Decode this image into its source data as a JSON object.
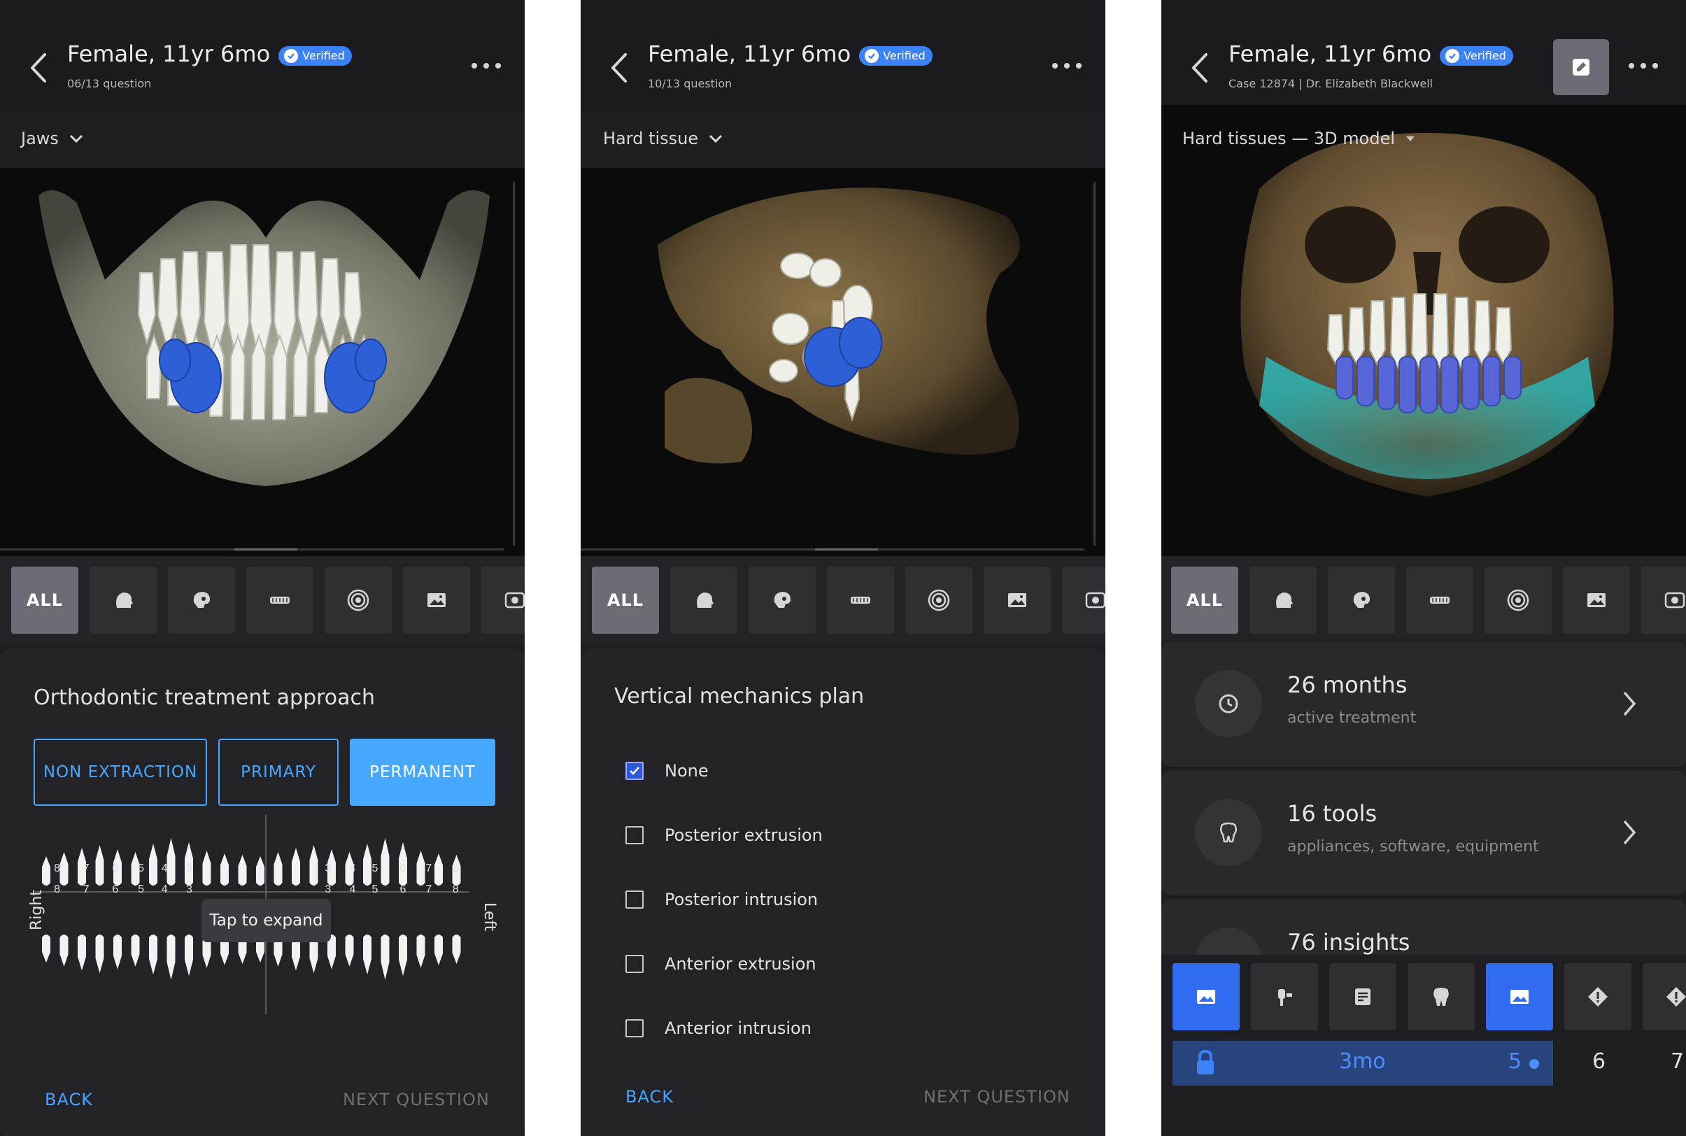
{
  "colors": {
    "accent": "#46a8ff",
    "verified": "#3b82f6",
    "selected_tool": "#2f6cf0",
    "tooth_highlight": "#2d5fd6",
    "bg": "#1e1e22"
  },
  "panels": [
    {
      "header": {
        "title": "Female, 11yr 6mo",
        "badge": "Verified",
        "subtitle": "06/13 question"
      },
      "dropdown": "Jaws",
      "filter_all": "ALL",
      "question": {
        "title": "Orthodontic treatment approach",
        "options": [
          {
            "label": "NON EXTRACTION",
            "selected": false
          },
          {
            "label": "PRIMARY",
            "selected": false
          },
          {
            "label": "PERMANENT",
            "selected": true
          }
        ]
      },
      "tooth_chart": {
        "top_numbers": [
          "8",
          "7",
          "6",
          "5",
          "4",
          "3",
          "3",
          "4",
          "5",
          "6",
          "7",
          "8"
        ],
        "bottom_numbers": [
          "8",
          "7",
          "6",
          "5",
          "4",
          "3",
          "3",
          "4",
          "5",
          "6",
          "7",
          "8"
        ],
        "side_right": "Right",
        "side_left": "Left",
        "tooltip": "Tap to expand"
      },
      "footer": {
        "back": "BACK",
        "next": "NEXT QUESTION"
      }
    },
    {
      "header": {
        "title": "Female, 11yr 6mo",
        "badge": "Verified",
        "subtitle": "10/13 question"
      },
      "dropdown": "Hard tissue",
      "filter_all": "ALL",
      "question": {
        "title": "Vertical mechanics plan",
        "checkboxes": [
          {
            "label": "None",
            "checked": true
          },
          {
            "label": "Posterior extrusion",
            "checked": false
          },
          {
            "label": "Posterior intrusion",
            "checked": false
          },
          {
            "label": "Anterior extrusion",
            "checked": false
          },
          {
            "label": "Anterior intrusion",
            "checked": false
          }
        ]
      },
      "footer": {
        "back": "BACK",
        "next": "NEXT QUESTION"
      }
    },
    {
      "header": {
        "title": "Female, 11yr 6mo",
        "badge": "Verified",
        "subtitle": "Case 12874 | Dr. Elizabeth Blackwell"
      },
      "dropdown": "Hard tissues — 3D model",
      "filter_all": "ALL",
      "cards": [
        {
          "main": "26 months",
          "sub": "active treatment",
          "icon": "clock-icon"
        },
        {
          "main": "16 tools",
          "sub": "appliances, software, equipment",
          "icon": "tooth-tool-icon"
        },
        {
          "main": "76 insights",
          "sub": "",
          "icon": "insight-icon"
        }
      ],
      "timeline": {
        "slider_label": "3mo",
        "slider_value": "5",
        "numbers": [
          "6",
          "7"
        ]
      }
    }
  ]
}
